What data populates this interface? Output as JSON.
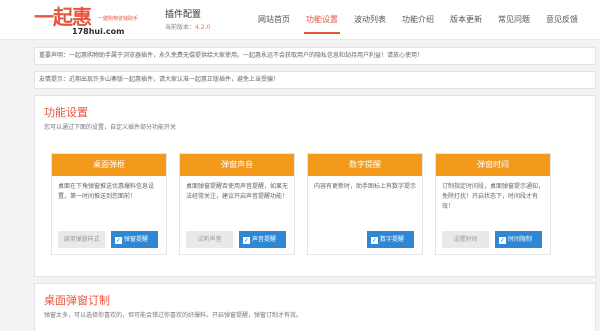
{
  "header": {
    "logo_text": "一起惠",
    "logo_url": "178hui.com",
    "logo_slogan": "一键购物省钱助手",
    "plugin_title": "插件配置",
    "version_label": "当前版本：",
    "version": "4.2.0",
    "nav": [
      {
        "label": "网站首页"
      },
      {
        "label": "功能设置"
      },
      {
        "label": "波动列表"
      },
      {
        "label": "功能介绍"
      },
      {
        "label": "版本更新"
      },
      {
        "label": "常见问题"
      },
      {
        "label": "意见反馈"
      }
    ],
    "accent_color": "#e8553e"
  },
  "notices": {
    "statement": "重要声明：一起惠购物助手属于浏览器插件，永久免费无偿提供给大家使用。一起惠永远不会获取用户的隐私信息和劫持用户利益！请放心使用！",
    "tip": "友情提示：近期出现许多山寨版一起惠插件，请大家认准一起惠正版插件，避免上当受骗！"
  },
  "settings": {
    "title": "功能设置",
    "description": "您可以通过下面的设置，自定义插件部分功能开关",
    "cards": [
      {
        "title": "桌面弹框",
        "body": "桌面在下角弹窗推送优惠爆料信息设置，第一时间推送到您面前！",
        "secondary_btn": "调用弹窗样式",
        "primary_btn": "弹窗提醒",
        "checked": true
      },
      {
        "title": "弹窗声音",
        "body": "桌面弹窗提醒否使用声音提醒，如果无法经常关注，建议开启声音提醒功能！",
        "secondary_btn": "试听声音",
        "primary_btn": "声音提醒",
        "checked": true
      },
      {
        "title": "数字提醒",
        "body": "内容有更新时，助手图标上有数字提示",
        "secondary_btn": "",
        "primary_btn": "数字提醒",
        "checked": true
      },
      {
        "title": "弹窗时间",
        "body": "订制指定时间段，桌面弹窗提示通知，免除打扰！开启状态下，时间段才有效！",
        "secondary_btn": "设置时间",
        "primary_btn": "时间限制",
        "checked": true
      }
    ],
    "header_color": "#f39a1c",
    "button_color": "#2f86d3"
  },
  "subscription": {
    "title": "桌面弹窗订制",
    "description": "弹窗太多，可以选择你喜欢的，但可能会错过你喜欢的好爆料。开启弹窗提醒，弹窗订制才有效。"
  }
}
